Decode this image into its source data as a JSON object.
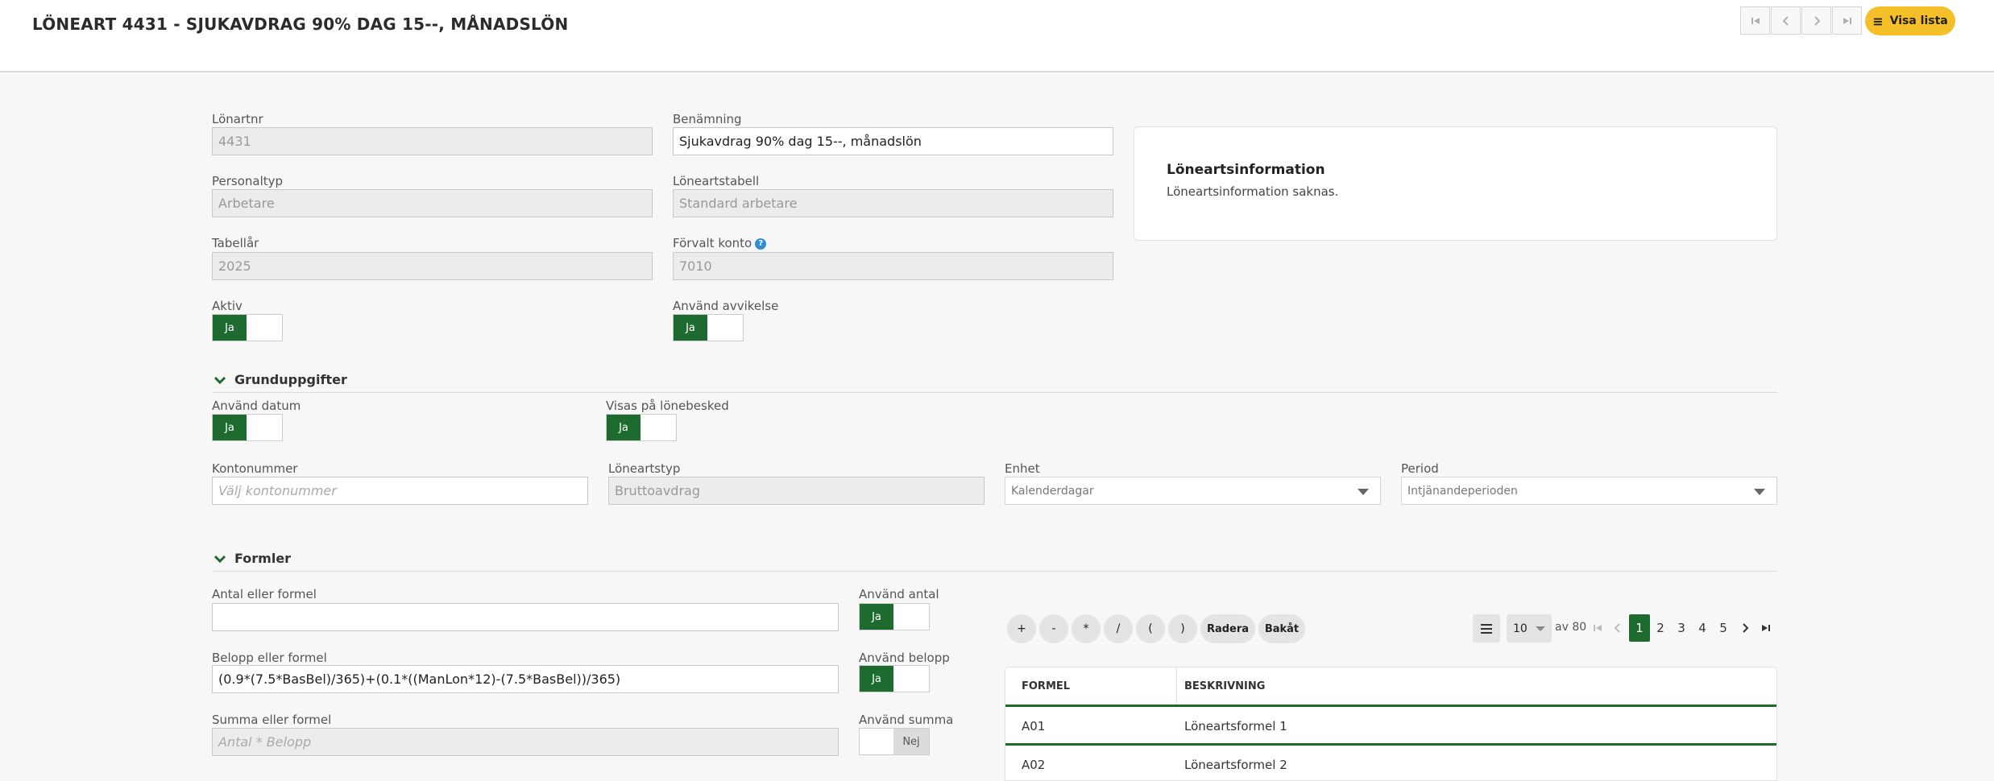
{
  "header": {
    "title": "LÖNEART 4431 - SJUKAVDRAG 90% DAG 15--, MÅNADSLÖN",
    "visa_lista_label": "Visa lista"
  },
  "form": {
    "lonartnr": {
      "label": "Lönartnr",
      "value": "4431"
    },
    "benamning": {
      "label": "Benämning",
      "value": "Sjukavdrag 90% dag 15--, månadslön"
    },
    "personaltyp": {
      "label": "Personaltyp",
      "value": "Arbetare"
    },
    "loneartstabell": {
      "label": "Löneartstabell",
      "value": "Standard arbetare"
    },
    "tabellar": {
      "label": "Tabellår",
      "value": "2025"
    },
    "forvalt_konto": {
      "label": "Förvalt konto",
      "value": "7010"
    },
    "aktiv": {
      "label": "Aktiv",
      "value": "Ja"
    },
    "anvand_avvikelse": {
      "label": "Använd avvikelse",
      "value": "Ja"
    }
  },
  "info_card": {
    "title": "Löneartsinformation",
    "text": "Löneartsinformation saknas."
  },
  "grunduppgifter": {
    "title": "Grunduppgifter",
    "anvand_datum": {
      "label": "Använd datum",
      "value": "Ja"
    },
    "visas_pa_lonebesked": {
      "label": "Visas på lönebesked",
      "value": "Ja"
    },
    "kontonummer": {
      "label": "Kontonummer",
      "placeholder": "Välj kontonummer"
    },
    "loneartstyp": {
      "label": "Löneartstyp",
      "value": "Bruttoavdrag"
    },
    "enhet": {
      "label": "Enhet",
      "value": "Kalenderdagar"
    },
    "period": {
      "label": "Period",
      "value": "Intjänandeperioden"
    }
  },
  "formler": {
    "title": "Formler",
    "antal": {
      "label": "Antal eller formel",
      "value": ""
    },
    "anvand_antal": {
      "label": "Använd antal",
      "value": "Ja"
    },
    "belopp": {
      "label": "Belopp eller formel",
      "value": "(0.9*(7.5*BasBel)/365)+(0.1*((ManLon*12)-(7.5*BasBel))/365)"
    },
    "anvand_belopp": {
      "label": "Använd belopp",
      "value": "Ja"
    },
    "summa": {
      "label": "Summa eller formel",
      "placeholder": "Antal * Belopp"
    },
    "anvand_summa": {
      "label": "Använd summa",
      "value": "Nej"
    },
    "operators": [
      "+",
      "-",
      "*",
      "/",
      "(",
      ")"
    ],
    "radera_label": "Radera",
    "bakat_label": "Bakåt"
  },
  "pagination": {
    "page_size": "10",
    "of_text": "av 80",
    "pages": [
      "1",
      "2",
      "3",
      "4",
      "5"
    ],
    "active_page": "1"
  },
  "formula_table": {
    "headers": [
      "FORMEL",
      "BESKRIVNING"
    ],
    "rows": [
      {
        "formel": "A01",
        "beskrivning": "Löneartsformel 1"
      },
      {
        "formel": "A02",
        "beskrivning": "Löneartsformel 2"
      }
    ]
  },
  "colors": {
    "accent_green": "#1e6b2f",
    "button_yellow": "#f5bf2a",
    "help_blue": "#2d8fd5"
  }
}
